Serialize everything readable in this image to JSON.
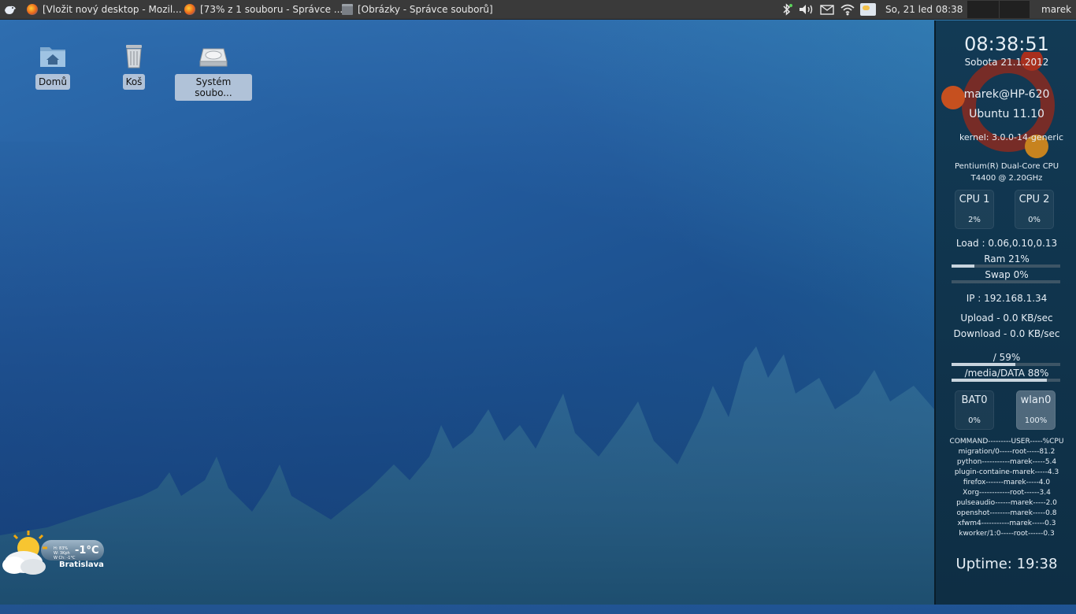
{
  "panel": {
    "tasks": [
      {
        "label": "[Vložit nový desktop - Mozil..."
      },
      {
        "label": "[73% z 1 souboru - Správce ..."
      },
      {
        "label": "[Obrázky - Správce souborů]"
      }
    ],
    "clock": "So, 21 led  08:38",
    "user": "marek"
  },
  "desktop_icons": [
    {
      "label": "Domů"
    },
    {
      "label": "Koš"
    },
    {
      "label": "Systém soubo..."
    }
  ],
  "conky": {
    "time": "08:38:51",
    "date": "Sobota 21.1.2012",
    "host": "marek@HP-620",
    "os": "Ubuntu 11.10",
    "kernel": "kernel: 3.0.0-14-generic",
    "cpu_model_1": "Pentium(R) Dual-Core CPU",
    "cpu_model_2": "T4400  @ 2.20GHz",
    "cpu1_label": "CPU 1",
    "cpu1_value": "2%",
    "cpu2_label": "CPU 2",
    "cpu2_value": "0%",
    "load": "Load : 0.06,0.10,0.13",
    "ram": "Ram 21%",
    "ram_fraction": 0.21,
    "swap": "Swap 0%",
    "swap_fraction": 0.0,
    "ip": "IP : 192.168.1.34",
    "upload": "Upload - 0.0 KB/sec",
    "download": "Download - 0.0 KB/sec",
    "fs_root": "/ 59%",
    "fs_root_fraction": 0.59,
    "fs_data": "/media/DATA 88%",
    "fs_data_fraction": 0.88,
    "bat_label": "BAT0",
    "bat_value": "0%",
    "wlan_label": "wlan0",
    "wlan_value": "100%",
    "processes": [
      "COMMAND---------USER-----%CPU",
      "migration/0-----root-----81.2",
      "python-----------marek-----5.4",
      "plugin-containe-marek-----4.3",
      "firefox-------marek-----4.0",
      "Xorg------------root------3.4",
      "pulseaudio------marek-----2.0",
      "openshot--------marek-----0.8",
      "xfwm4-----------marek-----0.3",
      "kworker/1:0-----root------0.3"
    ],
    "uptime": "Uptime: 19:38"
  },
  "weather": {
    "temp": "-1°C",
    "city": "Bratislava",
    "line1": "H: 83%",
    "line2": "W: 3Kph",
    "line3": "W Ch: -1°C"
  },
  "colors": {
    "panel": "#3a3a3a",
    "conky_bg": "#123a55",
    "wallpaper": "#225a9c"
  }
}
